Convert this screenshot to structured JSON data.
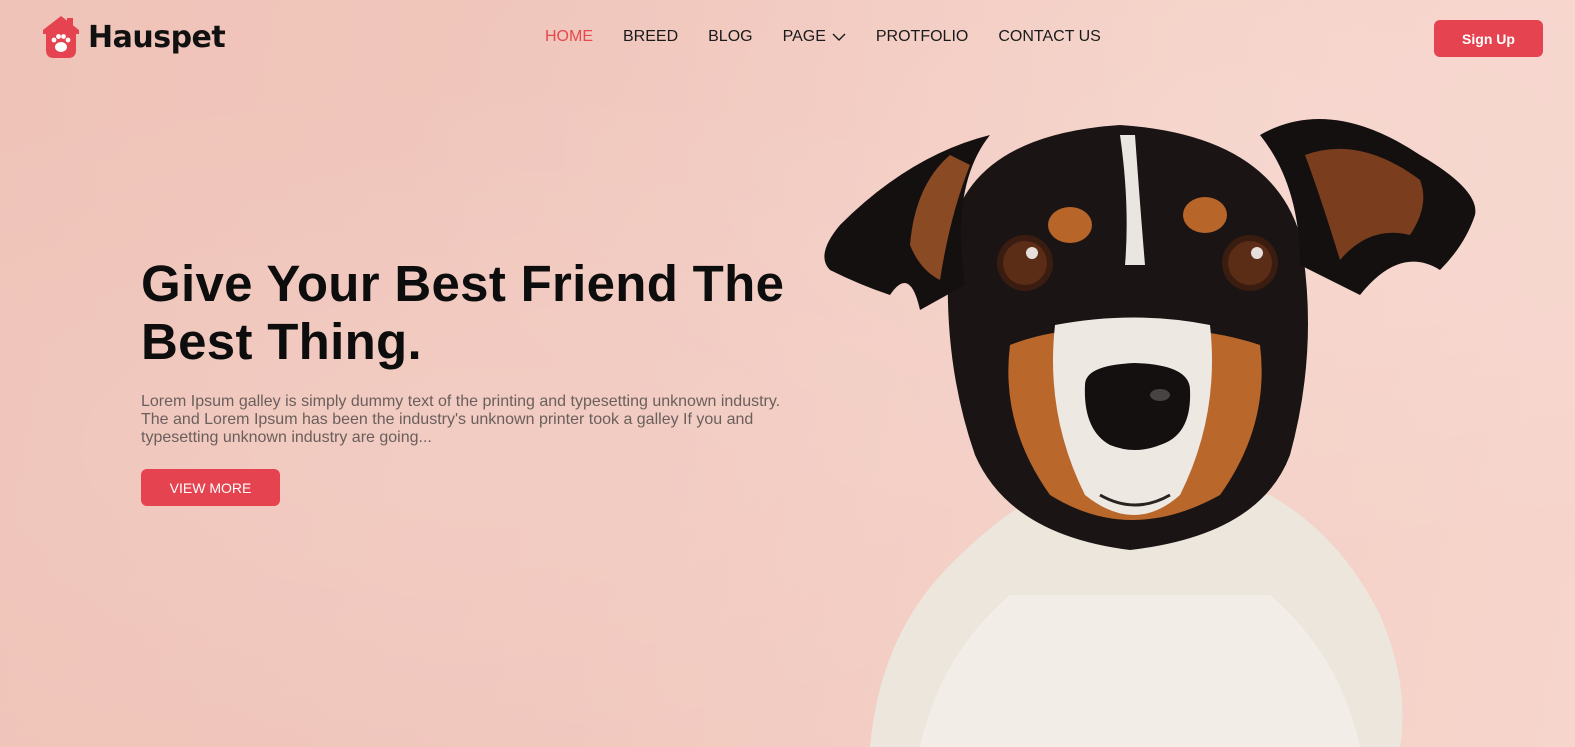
{
  "brand": {
    "name": "Hauspet",
    "accent": "#e4434f"
  },
  "nav": {
    "items": [
      {
        "label": "HOME",
        "active": true
      },
      {
        "label": "BREED",
        "active": false
      },
      {
        "label": "BLOG",
        "active": false
      },
      {
        "label": "PAGE",
        "active": false,
        "dropdown": true
      },
      {
        "label": "PROTFOLIO",
        "active": false
      },
      {
        "label": "CONTACT US",
        "active": false
      }
    ]
  },
  "header": {
    "signup_label": "Sign Up"
  },
  "hero": {
    "title_line1": "Give Your Best Friend The",
    "title_line2": "Best Thing.",
    "body_line1": "Lorem Ipsum galley is simply dummy text of the printing and typesetting unknown industry.",
    "body_line2": "The and Lorem Ipsum has been the industry's unknown printer took a galley If you and",
    "body_line3": "typesetting unknown industry are going...",
    "cta_label": "VIEW MORE"
  },
  "icons": {
    "logo": "house-paw-icon",
    "dropdown": "chevron-down-icon"
  }
}
